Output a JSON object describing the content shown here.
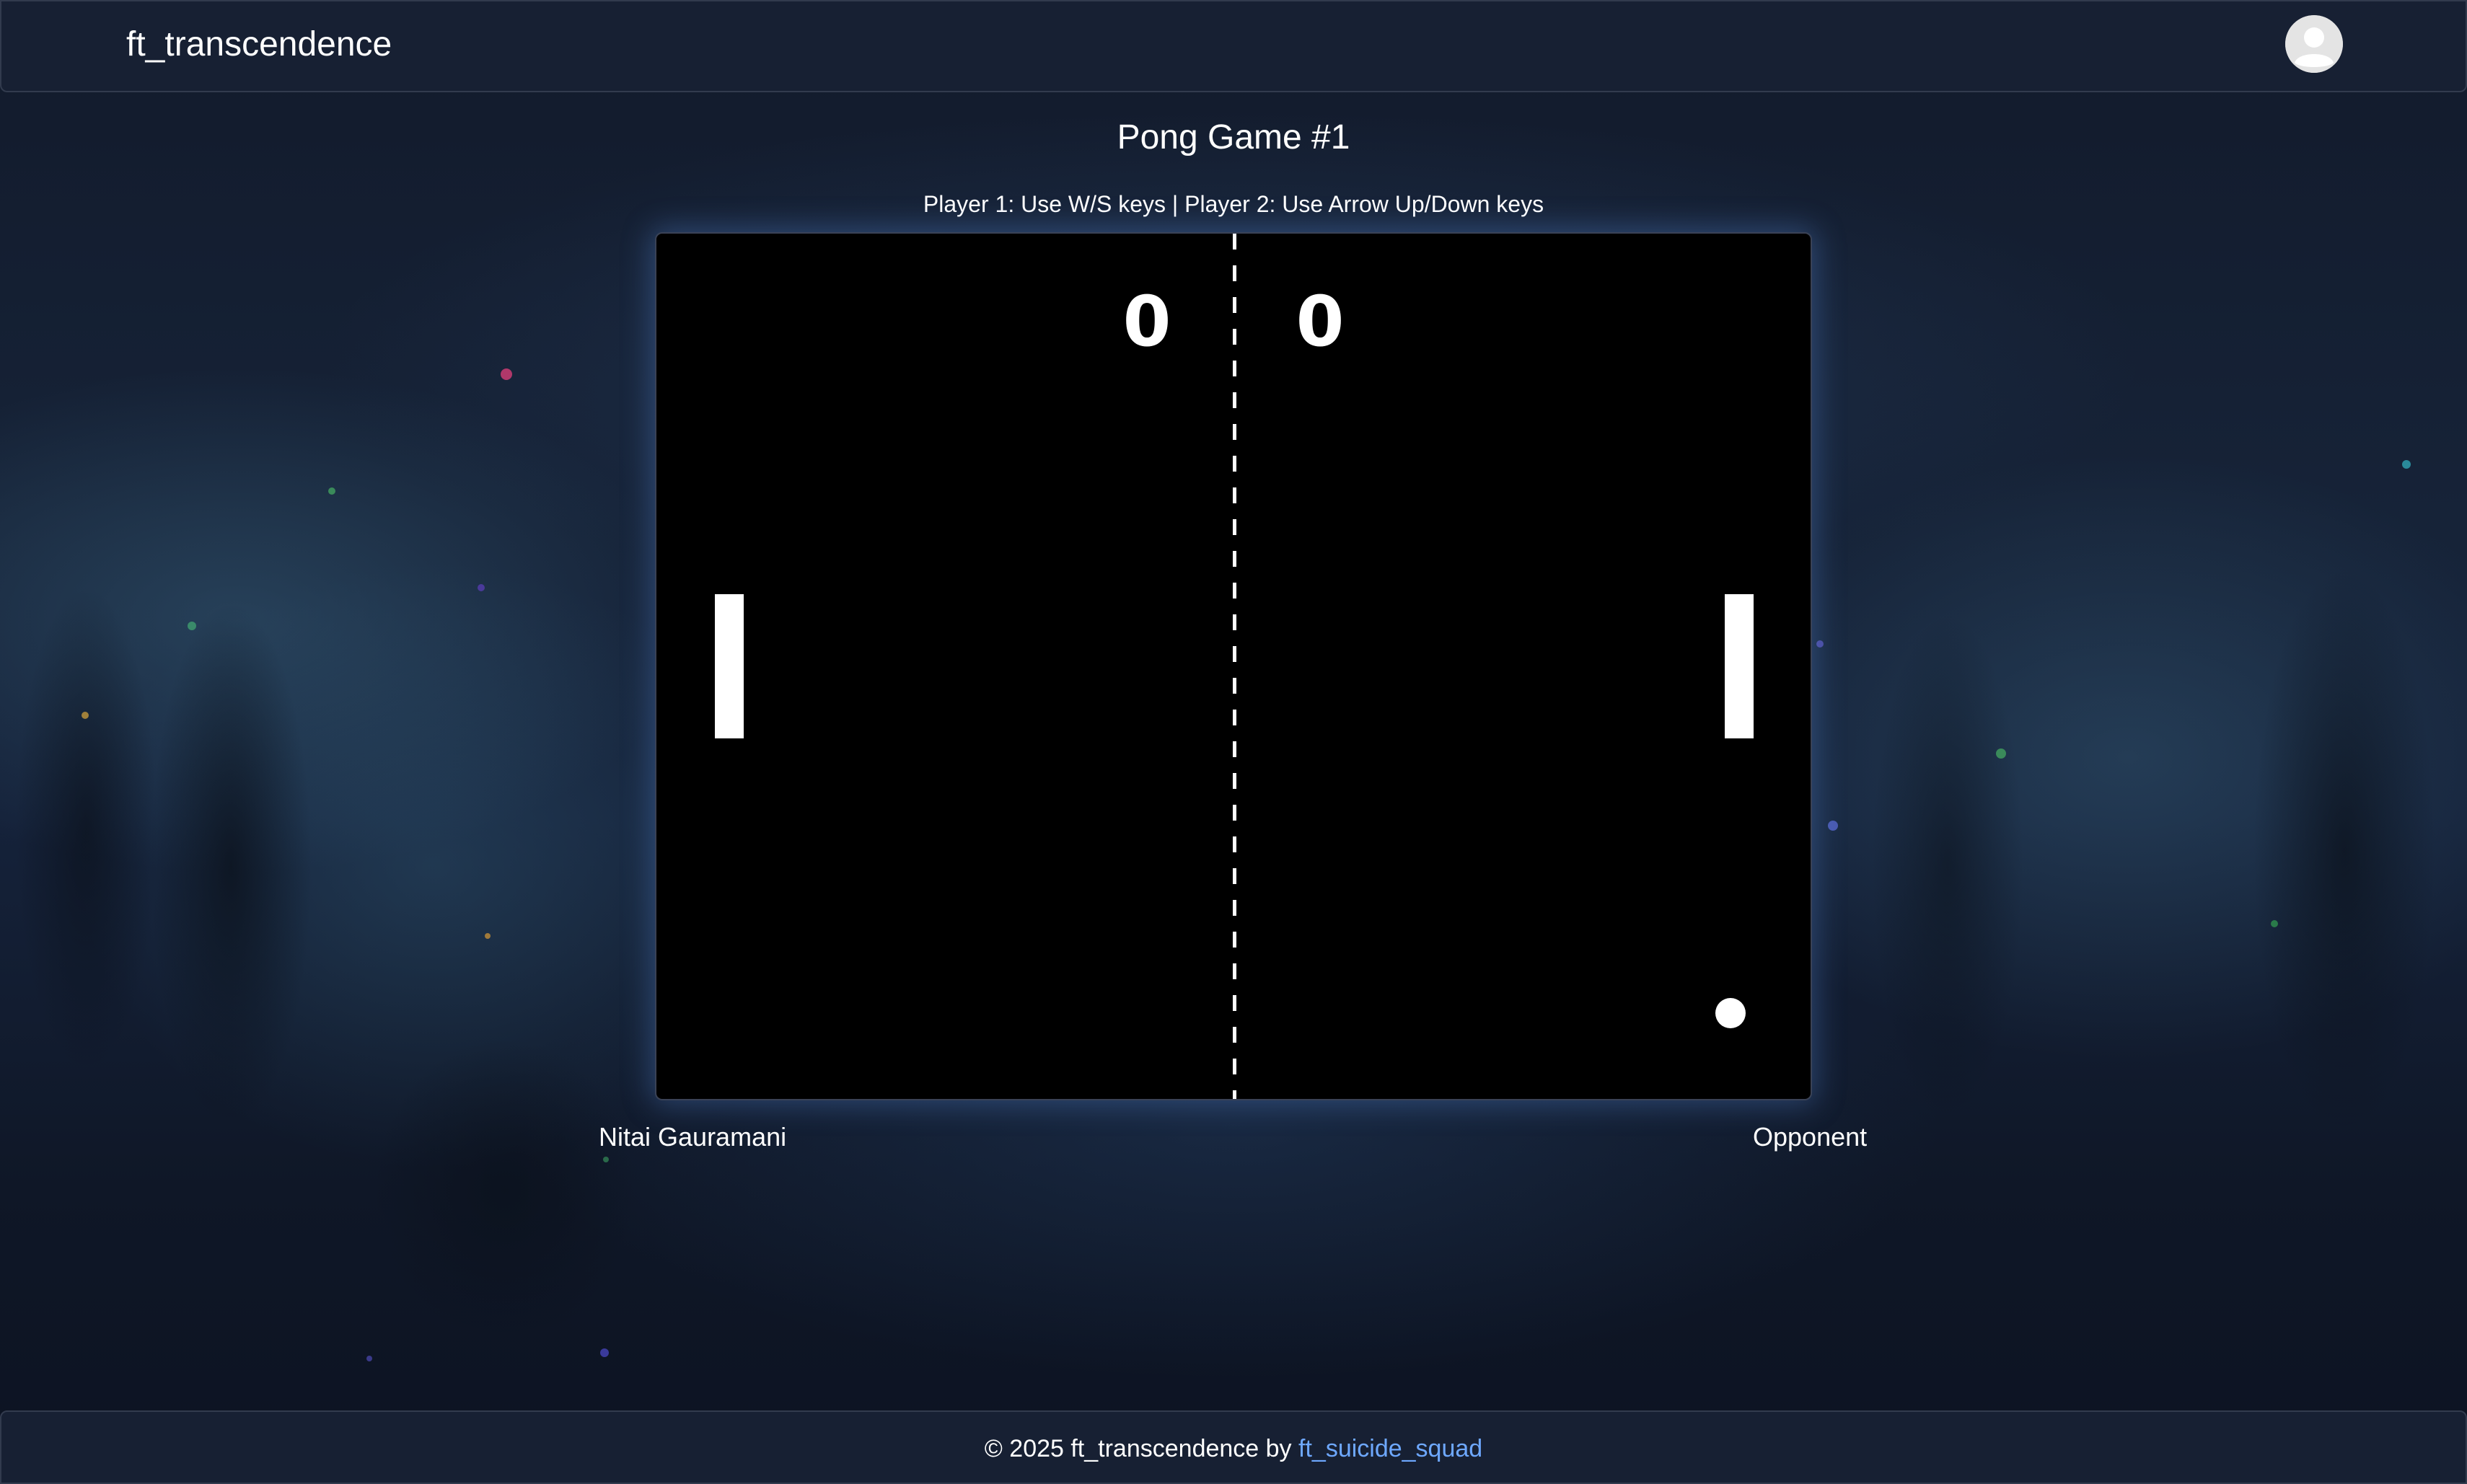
{
  "header": {
    "brand": "ft_transcendence",
    "avatar_icon": "user-avatar-icon"
  },
  "game": {
    "title": "Pong Game #1",
    "instructions": "Player 1: Use W/S keys | Player 2: Use Arrow Up/Down keys",
    "score_left": "0",
    "score_right": "0",
    "player_left": "Nitai Gauramani",
    "player_right": "Opponent"
  },
  "footer": {
    "text": "© 2025 ft_transcendence by ",
    "link": "ft_suicide_squad"
  },
  "colors": {
    "header_bg": "#172033",
    "board_bg": "#000000",
    "link": "#6ea8ff",
    "board_glow": "#5a8cdc"
  }
}
